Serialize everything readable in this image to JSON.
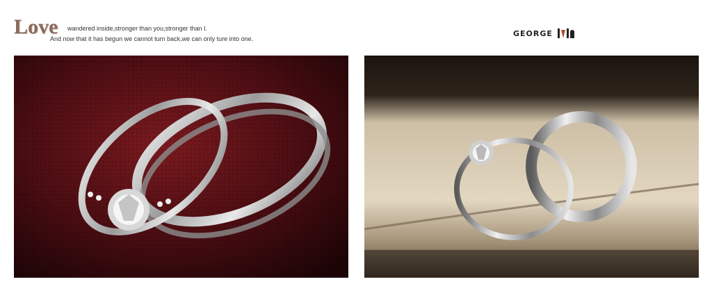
{
  "header": {
    "title_word": "Love",
    "line1": "wandered inside,stronger than you,stronger than I.",
    "line2": "And now that it has begun we cannot turn back,we can only ture into one."
  },
  "logo": {
    "text": "GEORGE",
    "icon": "george-liu-logo-mark"
  },
  "photos": [
    {
      "subject": "rings-on-red-fabric-photo"
    },
    {
      "subject": "rings-in-box-photo"
    }
  ]
}
